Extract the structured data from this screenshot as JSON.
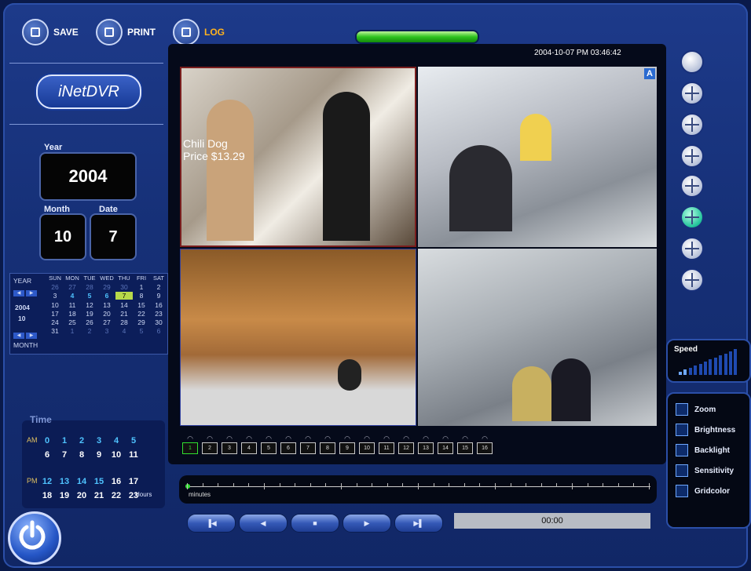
{
  "toolbar": {
    "save": "SAVE",
    "print": "PRINT",
    "log": "LOG"
  },
  "brand": "iNetDVR",
  "datetime": "2004-10-07 PM   03:46:42",
  "year_label": "Year",
  "year": "2004",
  "month_label": "Month",
  "month": "10",
  "date_label": "Date",
  "date": "7",
  "calendar": {
    "year_label": "YEAR",
    "year": "2004",
    "month": "10",
    "month_label": "MONTH",
    "days_header": [
      "SUN",
      "MON",
      "TUE",
      "WED",
      "THU",
      "FRI",
      "SAT"
    ],
    "weeks": [
      [
        "26",
        "27",
        "28",
        "29",
        "30",
        "1",
        "2"
      ],
      [
        "3",
        "4",
        "5",
        "6",
        "7",
        "8",
        "9"
      ],
      [
        "10",
        "11",
        "12",
        "13",
        "14",
        "15",
        "16"
      ],
      [
        "17",
        "18",
        "19",
        "20",
        "21",
        "22",
        "23"
      ],
      [
        "24",
        "25",
        "26",
        "27",
        "28",
        "29",
        "30"
      ],
      [
        "31",
        "1",
        "2",
        "3",
        "4",
        "5",
        "6"
      ]
    ]
  },
  "time": {
    "label": "Time",
    "am": "AM",
    "pm": "PM",
    "hours_label": "Hours",
    "am_row1": [
      "0",
      "1",
      "2",
      "3",
      "4",
      "5"
    ],
    "am_row2": [
      "6",
      "7",
      "8",
      "9",
      "10",
      "11"
    ],
    "pm_row1": [
      "12",
      "13",
      "14",
      "15",
      "16",
      "17"
    ],
    "pm_row2": [
      "18",
      "19",
      "20",
      "21",
      "22",
      "23"
    ]
  },
  "camera1_overlay": {
    "line1": "Chili Dog",
    "line2": "Price  $13.29"
  },
  "camera_badge": "A",
  "channels": [
    "1",
    "2",
    "3",
    "4",
    "5",
    "6",
    "7",
    "8",
    "9",
    "10",
    "11",
    "12",
    "13",
    "14",
    "15",
    "16"
  ],
  "speed_label": "Speed",
  "tools": [
    "Zoom",
    "Brightness",
    "Backlight",
    "Sensitivity",
    "Gridcolor"
  ],
  "timeline_label": "minutes",
  "playback_time": "00:00",
  "colors": {
    "accent": "#2ec21e",
    "panel": "#163077",
    "highlight": "#b7d94a"
  }
}
